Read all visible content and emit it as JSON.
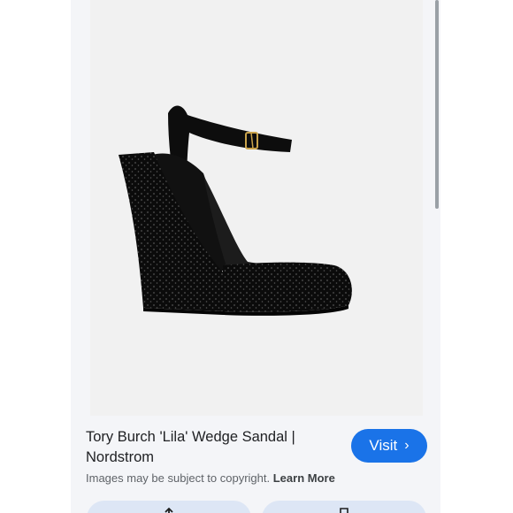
{
  "result": {
    "title": "Tory Burch 'Lila' Wedge Sandal | Nordstrom",
    "visit_label": "Visit",
    "copyright_text": "Images may be subject to copyright.",
    "learn_more": "Learn More"
  },
  "actions": [
    {
      "icon": "share-icon"
    },
    {
      "icon": "bookmark-icon"
    }
  ],
  "colors": {
    "accent": "#1a73e8",
    "card_bg": "#f4f5f8",
    "action_bg": "#dde6f5"
  }
}
